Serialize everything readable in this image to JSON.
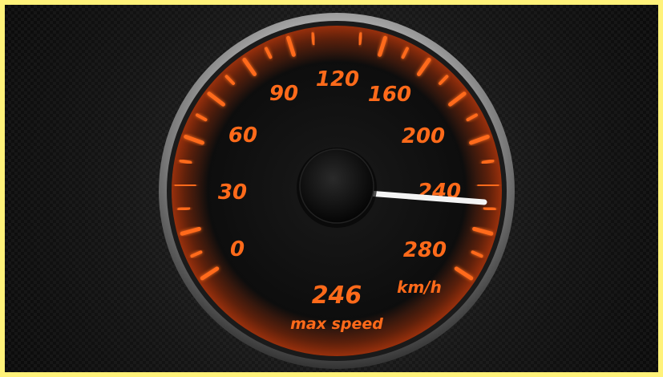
{
  "gauge": {
    "scale_labels": [
      "0",
      "30",
      "60",
      "90",
      "120",
      "160",
      "200",
      "240",
      "280"
    ],
    "unit": "km/h",
    "max_speed_value": "246",
    "max_speed_caption": "max speed",
    "needle_reading": 246,
    "accent_color": "#ff6a1a"
  }
}
